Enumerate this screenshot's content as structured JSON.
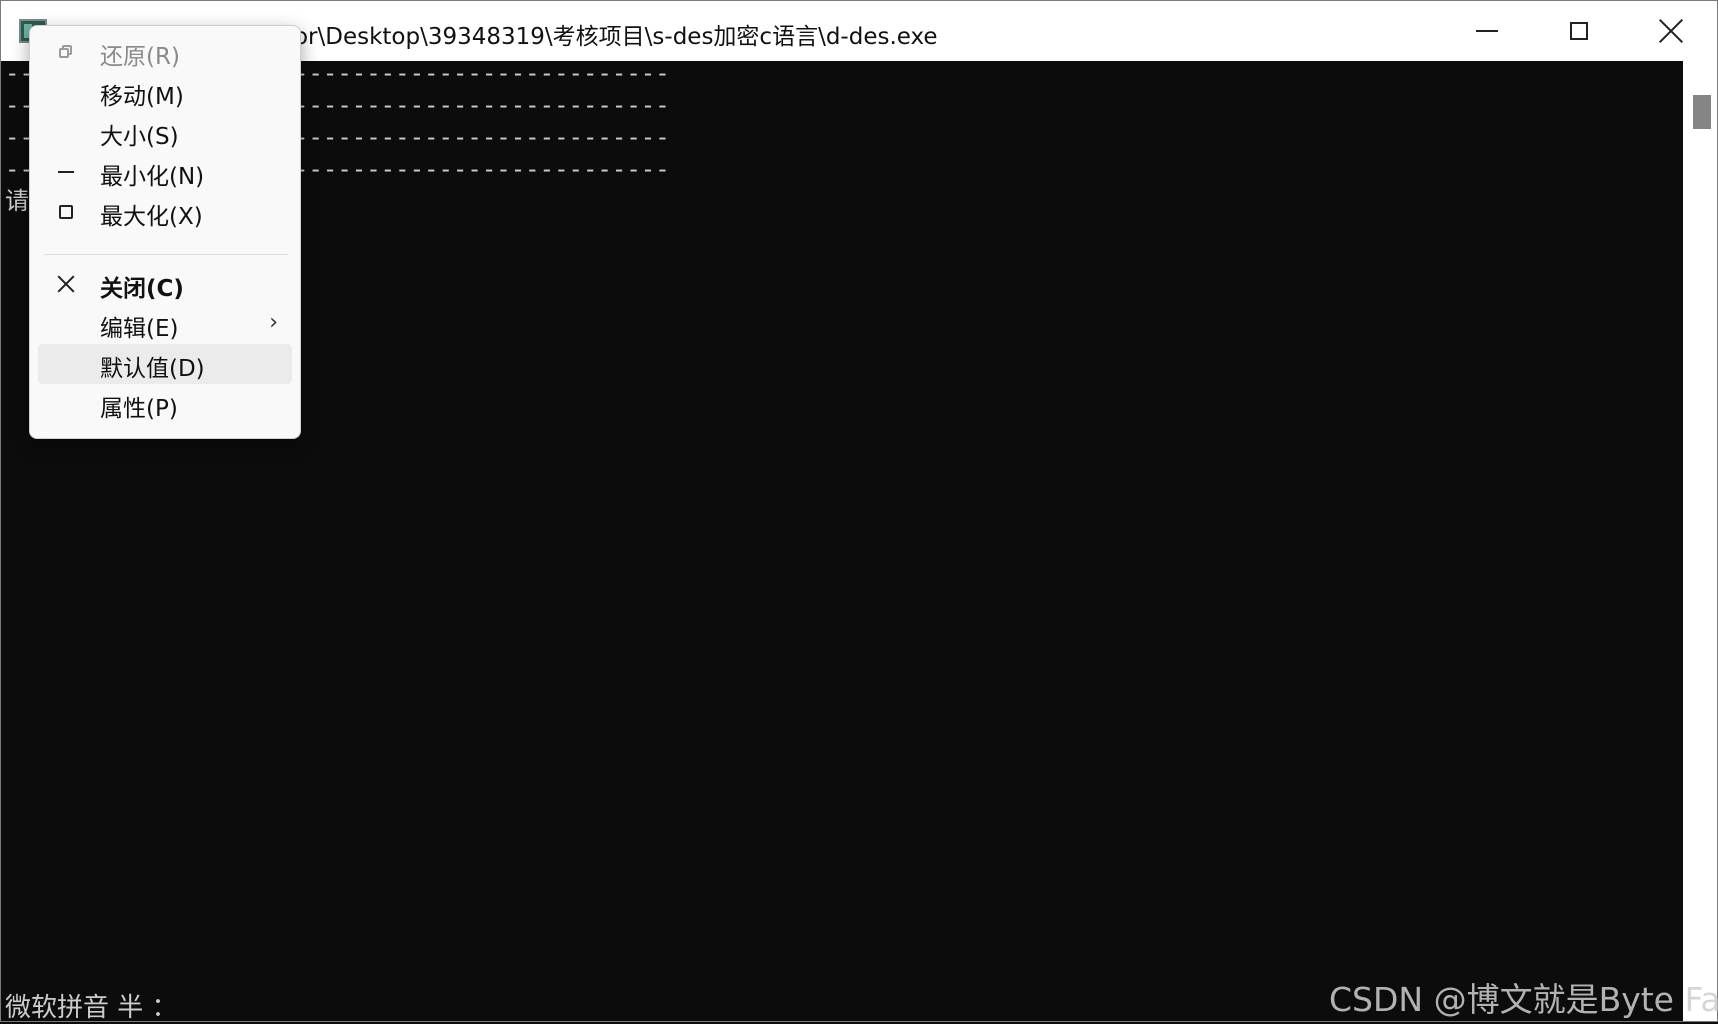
{
  "window": {
    "title": "C:\\Users\\Administrator\\Desktop\\39348319\\考核项目\\s-des加密c语言\\d-des.exe"
  },
  "console": {
    "lines": [
      "----------------------------------------------",
      "----------------------------------------------",
      "----------------------------------------------",
      "----------------------------------------------"
    ],
    "prompt": "请",
    "ime_status": "微软拼音 半 ："
  },
  "system_menu": {
    "items": [
      {
        "label": "还原(R)",
        "icon": "restore-icon",
        "state": "disabled"
      },
      {
        "label": "移动(M)",
        "icon": "",
        "state": "normal"
      },
      {
        "label": "大小(S)",
        "icon": "",
        "state": "normal"
      },
      {
        "label": "最小化(N)",
        "icon": "minimize-icon",
        "state": "normal"
      },
      {
        "label": "最大化(X)",
        "icon": "maximize-icon",
        "state": "normal"
      },
      {
        "label": "关闭(C)",
        "icon": "close-icon",
        "state": "bold"
      },
      {
        "label": "编辑(E)",
        "icon": "chevron-right-icon",
        "state": "submenu"
      },
      {
        "label": "默认值(D)",
        "icon": "",
        "state": "hover"
      },
      {
        "label": "属性(P)",
        "icon": "",
        "state": "normal"
      }
    ]
  },
  "watermark": "CSDN @博文就是Byte Fan",
  "colors": {
    "console_bg": "#0c0c0c",
    "console_text": "#cccccc",
    "menu_bg": "#f9f9f9",
    "menu_hover": "#ebebeb"
  }
}
